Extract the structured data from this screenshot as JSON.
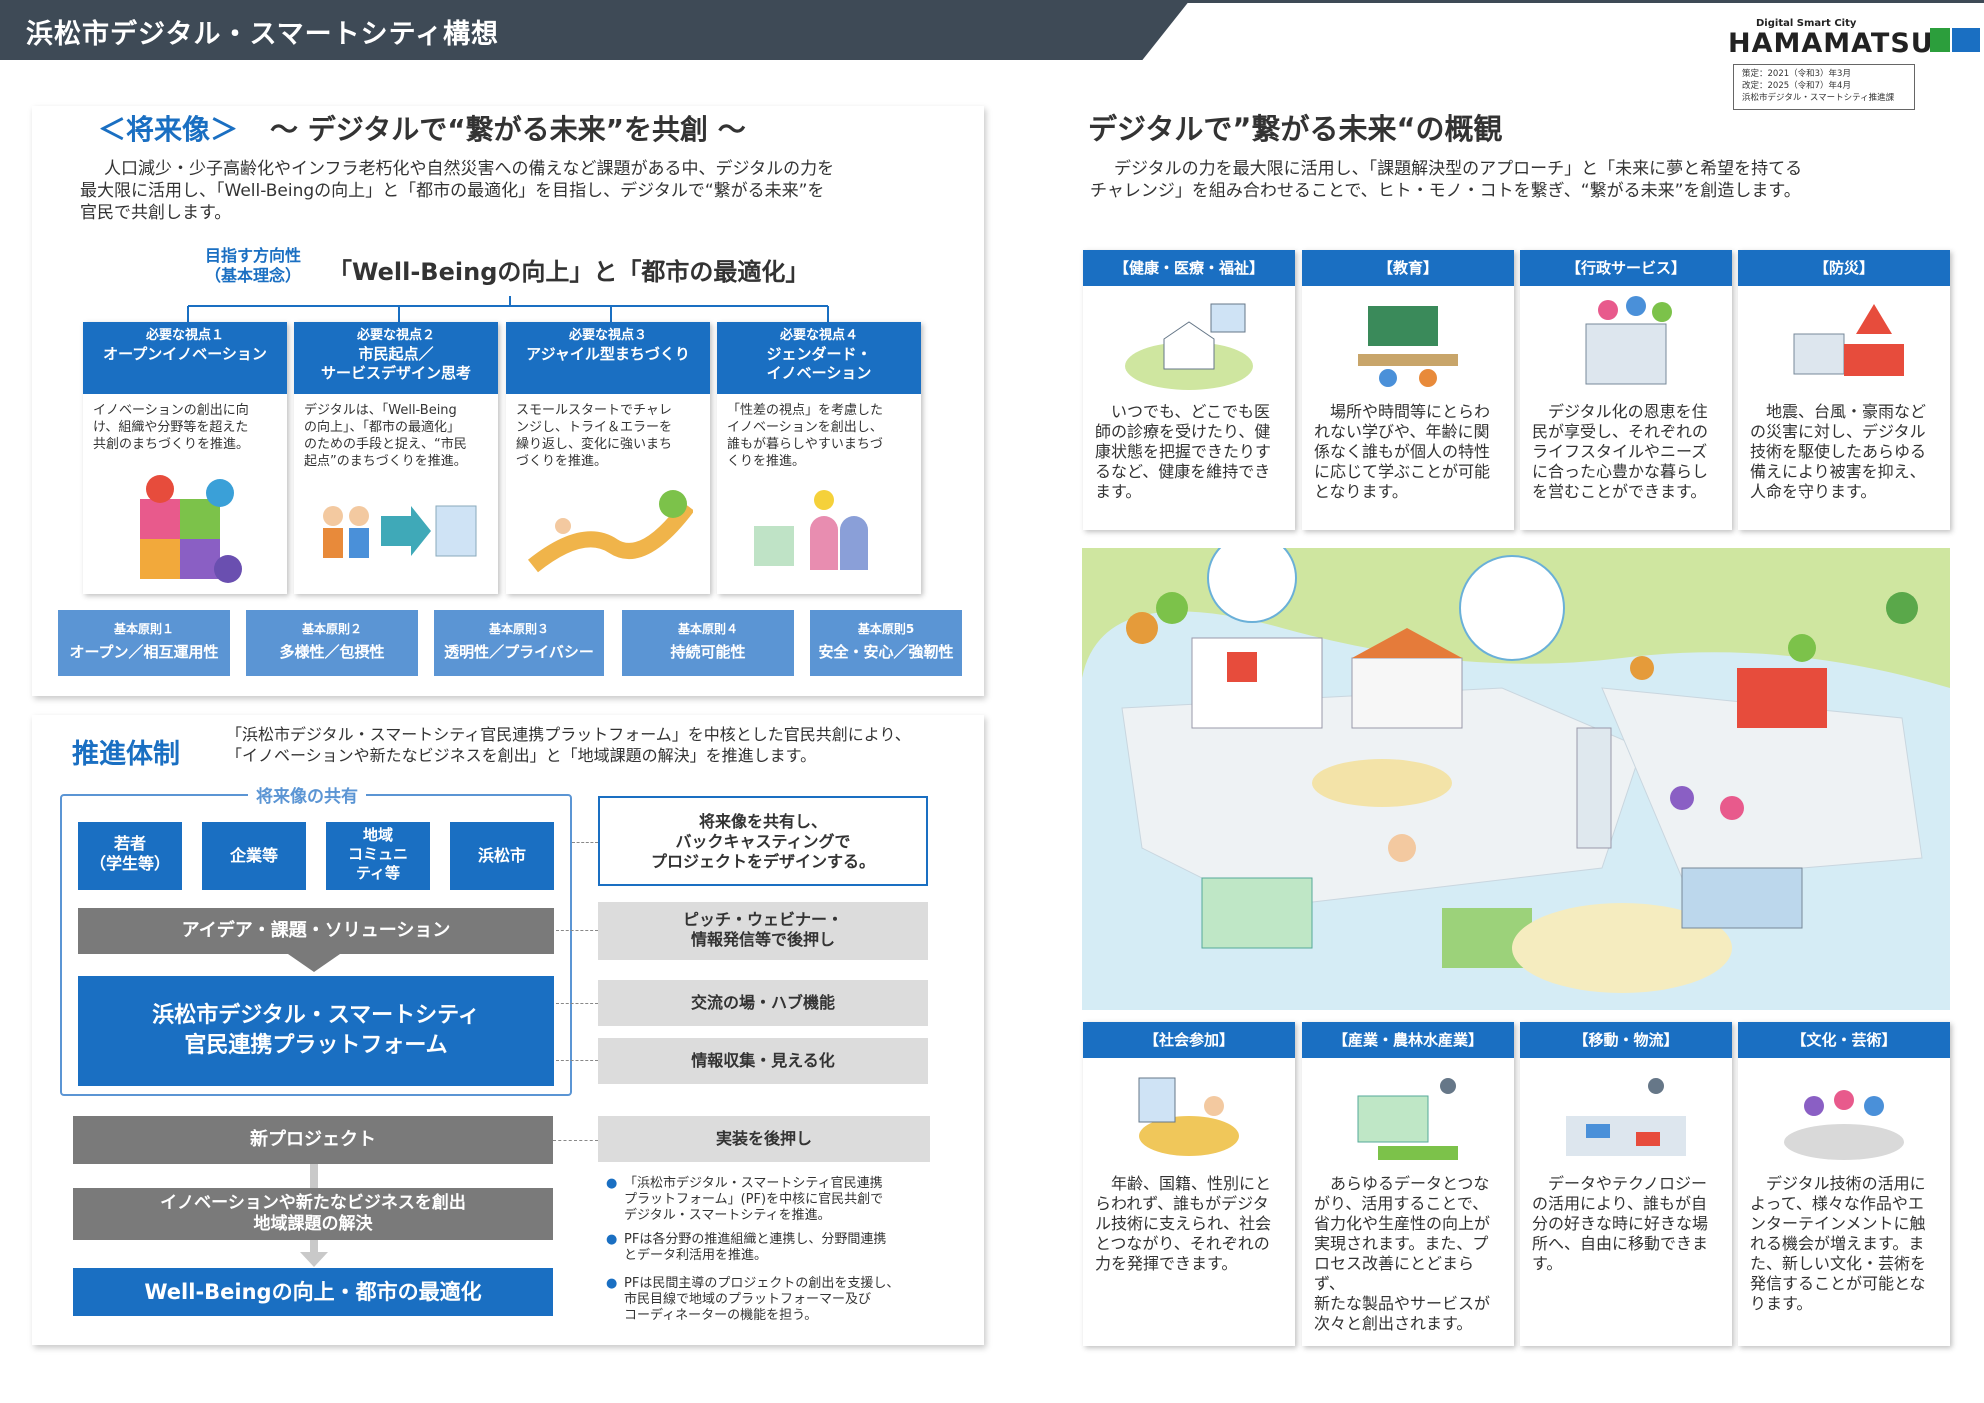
{
  "header": {
    "title": "浜松市デジタル・スマートシティ構想",
    "logo_small": "Digital Smart City",
    "logo_big": "HAMAMATSU",
    "date_lines": [
      "策定：2021（令和3）年3月",
      "改定：2025（令和7）年4月",
      "浜松市デジタル・スマートシティ推進課"
    ]
  },
  "future": {
    "bracket_title": "＜将来像＞",
    "subtitle": "～ デジタルで“繋がる未来”を共創 ～",
    "intro": [
      "人口減少・少子高齢化やインフラ老朽化や自然災害への備えなど課題がある中、デジタルの力を",
      "最大限に活用し、「Well-Beingの向上」と「都市の最適化」を目指し、デジタルで“繋がる未来”を",
      "官民で共創します。"
    ],
    "direction_label": [
      "目指す方向性",
      "（基本理念）"
    ],
    "direction": "「Well-Beingの向上」と「都市の最適化」",
    "pillars": [
      {
        "sub": "必要な視点１",
        "title": [
          "オープンイノベーション"
        ],
        "text": [
          "イノベーションの創出に向",
          "け、組織や分野等を超えた",
          "共創のまちづくりを推進。"
        ]
      },
      {
        "sub": "必要な視点２",
        "title": [
          "市民起点／",
          "サービスデザイン思考"
        ],
        "text": [
          "デジタルは、「Well-Being",
          "の向上」、「都市の最適化」",
          "のための手段と捉え、“市民",
          "起点”のまちづくりを推進。"
        ]
      },
      {
        "sub": "必要な視点３",
        "title": [
          "アジャイル型まちづくり"
        ],
        "text": [
          "スモールスタートでチャレ",
          "ンジし、トライ＆エラーを",
          "繰り返し、変化に強いまち",
          "づくりを推進。"
        ]
      },
      {
        "sub": "必要な視点４",
        "title": [
          "ジェンダード・",
          "イノベーション"
        ],
        "text": [
          "「性差の視点」を考慮した",
          "イノベーションを創出し、",
          "誰もが暮らしやすいまちづ",
          "くりを推進。"
        ]
      }
    ],
    "principles": [
      {
        "sub": "基本原則１",
        "title": "オープン／相互運用性"
      },
      {
        "sub": "基本原則２",
        "title": "多様性／包摂性"
      },
      {
        "sub": "基本原則３",
        "title": "透明性／プライバシー"
      },
      {
        "sub": "基本原則４",
        "title": "持続可能性"
      },
      {
        "sub": "基本原則5",
        "title": "安全・安心／強靭性"
      }
    ]
  },
  "promotion": {
    "title": "推進体制",
    "intro": [
      "「浜松市デジタル・スマートシティ官民連携プラットフォーム」を中核とした官民共創により、",
      "「イノベーションや新たなビジネスを創出」と「地域課題の解決」を推進します。"
    ],
    "share_label": "将来像の共有",
    "actors": [
      [
        "若者",
        "（学生等）"
      ],
      [
        "企業等"
      ],
      [
        "地域",
        "コミュニ",
        "ティ等"
      ],
      [
        "浜松市"
      ]
    ],
    "idea_bar": "アイデア・課題・ソリューション",
    "platform": [
      "浜松市デジタル・スマートシティ",
      "官民連携プラットフォーム"
    ],
    "new_project": "新プロジェクト",
    "innovation": [
      "イノベーションや新たなビジネスを創出",
      "地域課題の解決"
    ],
    "goal": "Well-Beingの向上・都市の最適化",
    "side_boxes": [
      [
        "将来像を共有し、",
        "バックキャスティングで",
        "プロジェクトをデザインする。"
      ],
      [
        "ピッチ・ウェビナー・",
        "情報発信等で後押し"
      ],
      [
        "交流の場・ハブ機能"
      ],
      [
        "情報収集・見える化"
      ],
      [
        "実装を後押し"
      ]
    ],
    "notes": [
      [
        "「浜松市デジタル・スマートシティ官民連携",
        "プラットフォーム」(PF)を中核に官民共創で",
        "デジタル・スマートシティを推進。"
      ],
      [
        "PFは各分野の推進組織と連携し、分野間連携",
        "とデータ利活用を推進。"
      ],
      [
        "PFは民間主導のプロジェクトの創出を支援し、",
        "市民目線で地域のプラットフォーマー及び",
        "コーディネーターの機能を担う。"
      ]
    ]
  },
  "overview": {
    "title": "デジタルで”繋がる未来“の概観",
    "intro": [
      "デジタルの力を最大限に活用し、「課題解決型のアプローチ」と「未来に夢と希望を持てる",
      "チャレンジ」を組み合わせることで、ヒト・モノ・コトを繋ぎ、“繋がる未来”を創造します。"
    ],
    "top_cats": [
      {
        "title": "【健康・医療・福祉】",
        "text": [
          "いつでも、どこでも医",
          "師の診療を受けたり、健",
          "康状態を把握できたりす",
          "るなど、健康を維持でき",
          "ます。"
        ]
      },
      {
        "title": "【教育】",
        "text": [
          "場所や時間等にとらわ",
          "れない学びや、年齢に関",
          "係なく誰もが個人の特性",
          "に応じて学ぶことが可能",
          "となります。"
        ]
      },
      {
        "title": "【行政サービス】",
        "text": [
          "デジタル化の恩恵を住",
          "民が享受し、それぞれの",
          "ライフスタイルやニーズ",
          "に合った心豊かな暮らし",
          "を営むことができます。"
        ]
      },
      {
        "title": "【防災】",
        "text": [
          "地震、台風・豪雨など",
          "の災害に対し、デジタル",
          "技術を駆使したあらゆる",
          "備えにより被害を抑え、",
          "人命を守ります。"
        ]
      }
    ],
    "bottom_cats": [
      {
        "title": "【社会参加】",
        "text": [
          "年齢、国籍、性別にと",
          "らわれず、誰もがデジタ",
          "ル技術に支えられ、社会",
          "とつながり、それぞれの",
          "力を発揮できます。"
        ]
      },
      {
        "title": "【産業・農林水産業】",
        "text": [
          "あらゆるデータとつな",
          "がり、活用することで、",
          "省力化や生産性の向上が",
          "実現されます。また、プ",
          "ロセス改善にとどまらず、",
          "新たな製品やサービスが",
          "次々と創出されます。"
        ]
      },
      {
        "title": "【移動・物流】",
        "text": [
          "データやテクノロジー",
          "の活用により、誰もが自",
          "分の好きな時に好きな場",
          "所へ、自由に移動できま",
          "す。"
        ]
      },
      {
        "title": "【文化・芸術】",
        "text": [
          "デジタル技術の活用に",
          "よって、様々な作品やエ",
          "ンターテインメントに触",
          "れる機会が増えます。ま",
          "た、新しい文化・芸術を",
          "発信することが可能とな",
          "ります。"
        ]
      }
    ]
  }
}
